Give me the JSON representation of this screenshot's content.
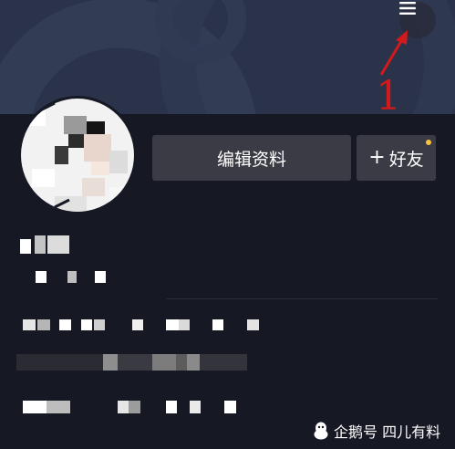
{
  "header": {
    "menu_icon": "hamburger-icon"
  },
  "annotation": {
    "number": "1",
    "color": "#d21a1a"
  },
  "profile": {
    "edit_label": "编辑资料",
    "add_friend_plus": "+",
    "add_friend_label": "好友",
    "notify_dot_color": "#f7c43b"
  },
  "watermark": {
    "text": "企鹅号 四儿有料",
    "icon": "penguin-icon"
  },
  "colors": {
    "background": "#161823",
    "cover": "#2a3349",
    "button": "#3a3b44"
  }
}
